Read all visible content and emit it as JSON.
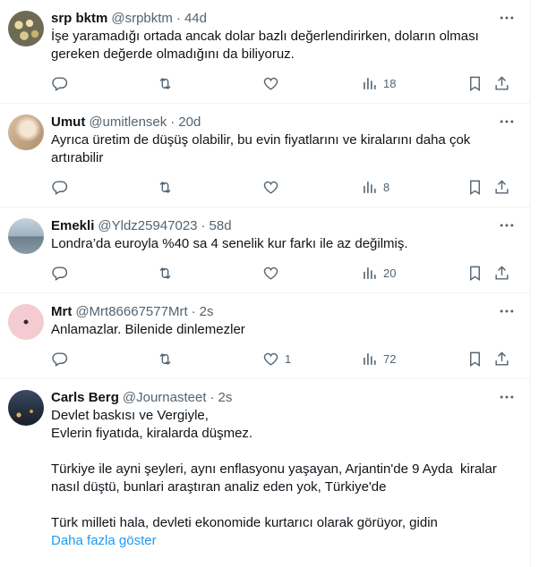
{
  "tweets": [
    {
      "name": "srp bktm",
      "handle": "@srpbktm",
      "time": "44d",
      "text": "İşe yaramadığı ortada ancak dolar bazlı değerlendirirken, doların olması gereken değerde olmadığını da biliyoruz.",
      "replies": "",
      "retweets": "",
      "likes": "",
      "views": "18",
      "avatar_color": "#8a8f6a"
    },
    {
      "name": "Umut",
      "handle": "@umitlensek",
      "time": "20d",
      "text": "Ayrıca üretim de düşüş olabilir, bu evin fiyatlarını ve kiralarını daha çok artırabilir",
      "replies": "",
      "retweets": "",
      "likes": "",
      "views": "8",
      "avatar_color": "#c9ab8c"
    },
    {
      "name": "Emekli",
      "handle": "@Yldz25947023",
      "time": "58d",
      "text": "Londra’da euroyla %40 sa 4 senelik kur farkı ile az değilmiş.",
      "replies": "",
      "retweets": "",
      "likes": "",
      "views": "20",
      "avatar_color": "#6f8193"
    },
    {
      "name": "Mrt",
      "handle": "@Mrt86667577Mrt",
      "time": "2s",
      "text": "Anlamazlar. Bilenide dinlemezler",
      "replies": "",
      "retweets": "",
      "likes": "1",
      "views": "72",
      "avatar_color": "#f1c9cf"
    },
    {
      "name": "Carls Berg",
      "handle": "@Journasteet",
      "time": "2s",
      "text": "Devlet baskısı ve Vergiyle,\nEvlerin fiyatıda, kiralarda düşmez.\n\nTürkiye ile ayni şeyleri, aynı enflasyonu yaşayan, Arjantin'de 9 Ayda  kiralar nasıl düştü, bunlari araştıran analiz eden yok, Türkiye'de\n\nTürk milleti hala, devleti ekonomide kurtarıcı olarak görüyor, gidin",
      "show_more": "Daha fazla göster",
      "avatar_color": "#2f3a4a"
    }
  ],
  "icons": {
    "more": "more-icon",
    "reply": "reply-icon",
    "retweet": "retweet-icon",
    "like": "heart-icon",
    "views": "views-icon",
    "bookmark": "bookmark-icon",
    "share": "share-icon"
  }
}
